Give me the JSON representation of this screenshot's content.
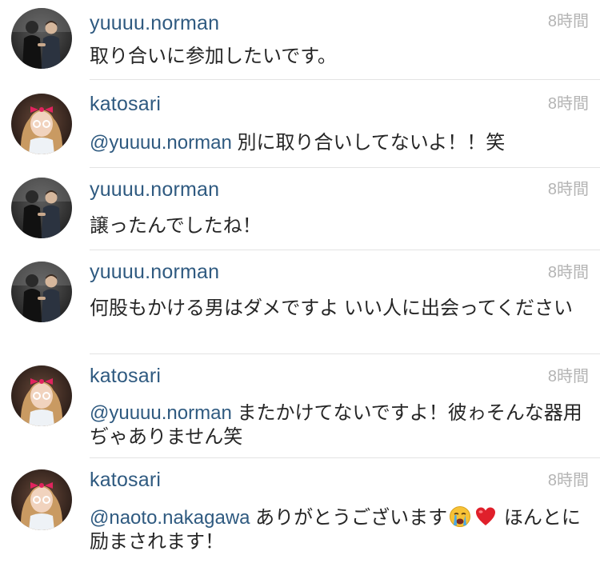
{
  "comments": [
    {
      "username": "yuuuu.norman",
      "time": "8時間",
      "mention": "",
      "text": "取り合いに参加したいです。",
      "avatar": "avatar-two-men"
    },
    {
      "username": "katosari",
      "time": "8時間",
      "mention": "@yuuuu.norman",
      "text": " 別に取り合いしてないよ！！笑",
      "avatar": "avatar-woman-pink-bow"
    },
    {
      "username": "yuuuu.norman",
      "time": "8時間",
      "mention": "",
      "text": "譲ったんでしたね！",
      "avatar": "avatar-two-men"
    },
    {
      "username": "yuuuu.norman",
      "time": "8時間",
      "mention": "",
      "text": "何股もかける男はダメですよ いい人に出会ってください",
      "avatar": "avatar-two-men"
    },
    {
      "username": "katosari",
      "time": "8時間",
      "mention": "@yuuuu.norman",
      "text": " またかけてないですよ！彼ゎそんな器用ぢゃありません笑",
      "avatar": "avatar-woman-pink-bow"
    },
    {
      "username": "katosari",
      "time": "8時間",
      "mention": "@naoto.nakagawa",
      "text_before": " ありがとうございます",
      "emojis": [
        "crying-face-emoji",
        "red-heart-emoji"
      ],
      "text_after": " ほんとに励まされます！",
      "avatar": "avatar-woman-pink-bow"
    }
  ],
  "colors": {
    "username": "#2f5a80",
    "timestamp": "#b4b4b4",
    "body_text": "#262626",
    "divider": "#e3e3e3"
  }
}
